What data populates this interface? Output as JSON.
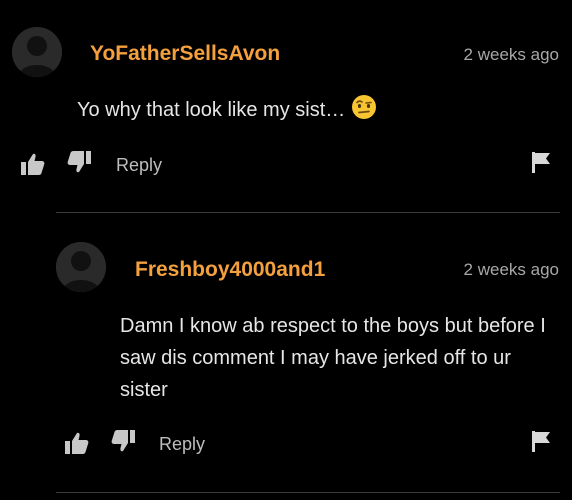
{
  "colors": {
    "accent": "#f4a13d",
    "background": "#000000",
    "text": "#e6e6e6",
    "muted": "#a8a8a8",
    "divider": "#3b3b3b"
  },
  "comments": [
    {
      "username": "YoFatherSellsAvon",
      "timestamp": "2 weeks ago",
      "text": "Yo why that look like my sist…",
      "emoji": "face-with-raised-eyebrow-emoji",
      "reply_label": "Reply",
      "icons": [
        "thumbs-up-icon",
        "thumbs-down-icon",
        "flag-icon"
      ]
    },
    {
      "username": "Freshboy4000and1",
      "timestamp": "2 weeks ago",
      "text": "Damn I know ab respect to the boys but before I saw dis comment I may have jerked off to ur sister",
      "reply_label": "Reply",
      "icons": [
        "thumbs-up-icon",
        "thumbs-down-icon",
        "flag-icon"
      ]
    }
  ]
}
